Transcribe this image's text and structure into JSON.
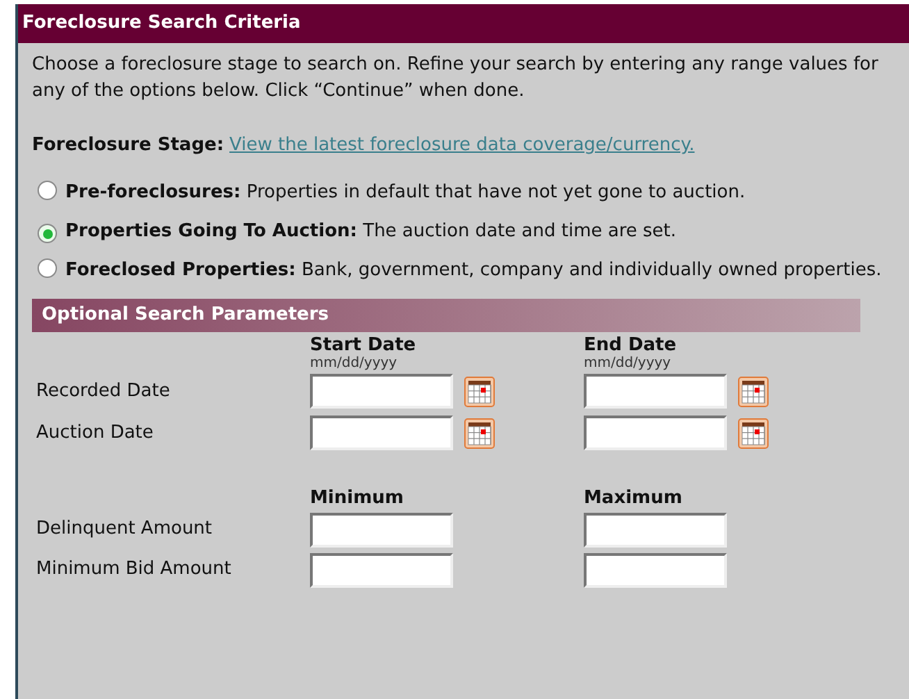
{
  "header": {
    "title": "Foreclosure Search Criteria"
  },
  "intro": "Choose a foreclosure stage to search on. Refine your search by entering any range values for any of the options below. Click “Continue” when done.",
  "stage": {
    "label": "Foreclosure Stage:",
    "link": "View the latest foreclosure data coverage/currency."
  },
  "options": [
    {
      "title": "Pre-foreclosures:",
      "text": "Properties in default that have not yet gone to auction.",
      "selected": false
    },
    {
      "title": "Properties Going To Auction:",
      "text": "The auction date and time are set.",
      "selected": true
    },
    {
      "title": "Foreclosed Properties:",
      "text": "Bank, government, company and individually owned properties.",
      "selected": false
    }
  ],
  "params": {
    "title": "Optional Search Parameters",
    "date_columns": [
      {
        "heading": "Start Date",
        "hint": "mm/dd/yyyy"
      },
      {
        "heading": "End Date",
        "hint": "mm/dd/yyyy"
      }
    ],
    "date_rows": [
      "Recorded Date",
      "Auction Date"
    ],
    "amount_columns": [
      {
        "heading": "Minimum"
      },
      {
        "heading": "Maximum"
      }
    ],
    "amount_rows": [
      "Delinquent Amount",
      "Minimum Bid Amount"
    ]
  }
}
